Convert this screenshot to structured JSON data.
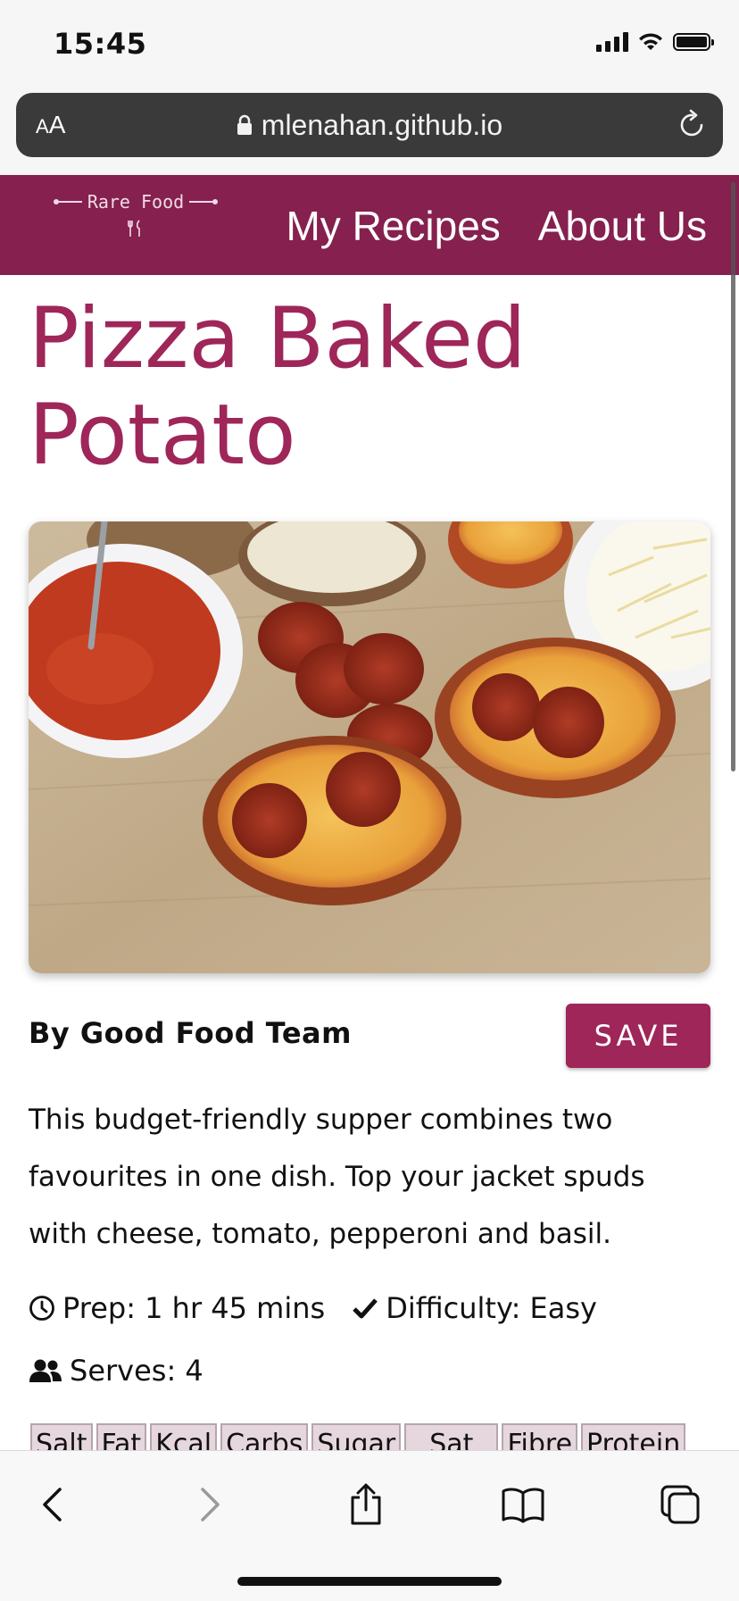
{
  "status": {
    "time": "15:45"
  },
  "browser": {
    "aa_label_small": "A",
    "aa_label_large": "A",
    "url": "mlenahan.github.io"
  },
  "site": {
    "logo_text": "Rare Food",
    "nav": [
      "My Recipes",
      "About Us"
    ]
  },
  "recipe": {
    "title": "Pizza Baked Potato",
    "image_alt": "Pizza baked potato skins topped with pepperoni, with tomato sauce and grated cheese",
    "author": "By Good Food Team",
    "save_label": "SAVE",
    "description": "This budget-friendly supper combines two favourites in one dish. Top your jacket spuds with cheese, tomato, pepperoni and basil.",
    "prep": "Prep: 1 hr 45 mins",
    "difficulty": "Difficulty: Easy",
    "serves": "Serves: 4",
    "nutrition_headers": [
      "Salt",
      "Fat",
      "Kcal",
      "Carbs",
      "Sugar",
      "Sat",
      "Fibre",
      "Protein"
    ]
  },
  "colors": {
    "brand": "#85204f",
    "accent": "#9e2659"
  },
  "icons": [
    "lock-icon",
    "reload-icon",
    "fork-knife-icon",
    "clock-icon",
    "check-icon",
    "users-icon",
    "back-icon",
    "forward-icon",
    "share-icon",
    "bookmarks-icon",
    "tabs-icon"
  ]
}
